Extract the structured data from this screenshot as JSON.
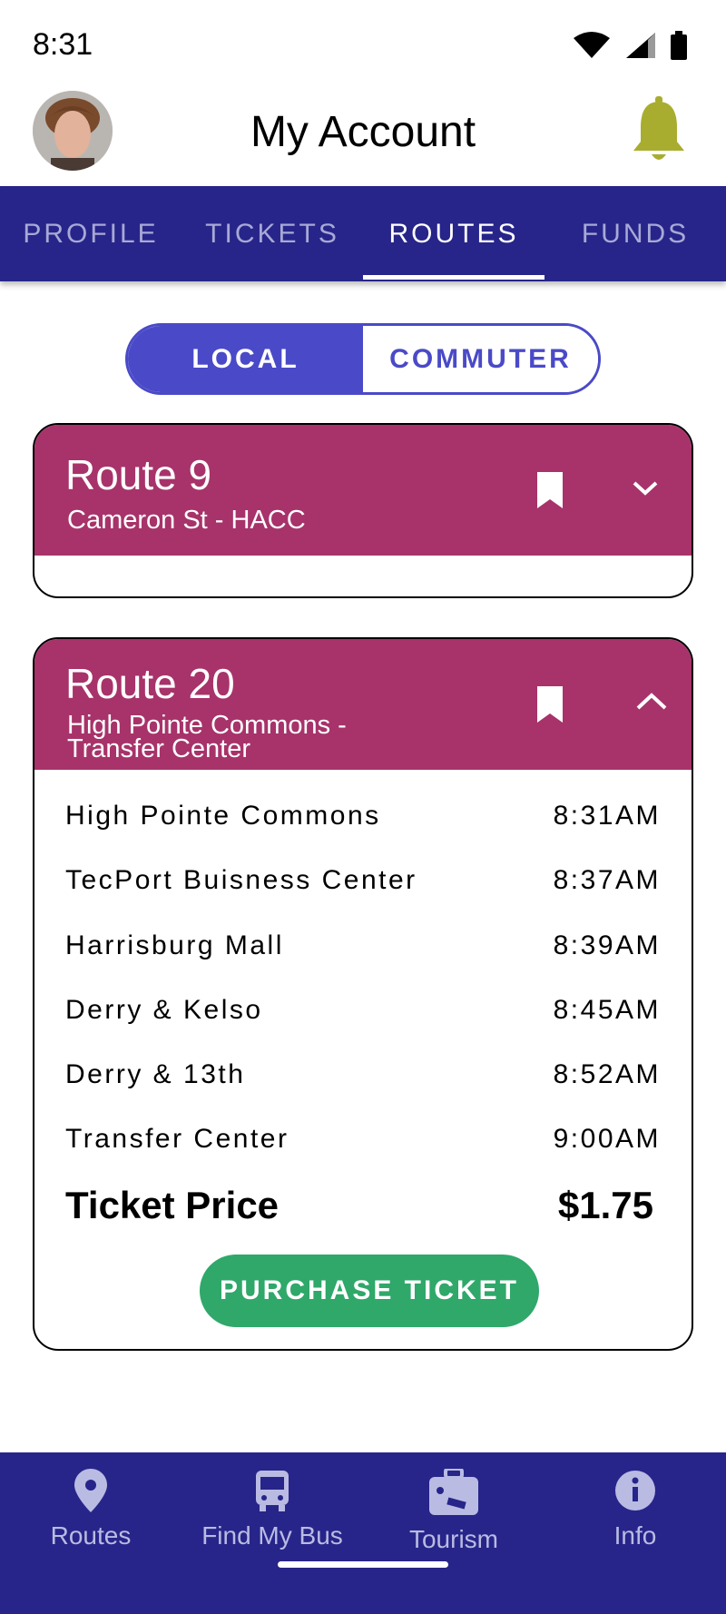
{
  "status_bar": {
    "time": "8:31"
  },
  "header": {
    "title": "My Account"
  },
  "tabs": [
    {
      "label": "PROFILE"
    },
    {
      "label": "TICKETS"
    },
    {
      "label": "ROUTES"
    },
    {
      "label": "FUNDS"
    }
  ],
  "active_tab": "ROUTES",
  "segment": {
    "local": "LOCAL",
    "commuter": "COMMUTER",
    "selected": "LOCAL"
  },
  "routes": [
    {
      "name": "Route 9",
      "subtitle": "Cameron St - HACC",
      "expanded": false
    },
    {
      "name": "Route 20",
      "subtitle_line1": "High Pointe Commons -",
      "subtitle_line2": "Transfer Center",
      "expanded": true,
      "stops": [
        {
          "name": "High Pointe Commons",
          "time": "8:31AM"
        },
        {
          "name": "TecPort Buisness Center",
          "time": "8:37AM"
        },
        {
          "name": "Harrisburg Mall",
          "time": "8:39AM"
        },
        {
          "name": "Derry & Kelso",
          "time": "8:45AM"
        },
        {
          "name": "Derry & 13th",
          "time": "8:52AM"
        },
        {
          "name": "Transfer Center",
          "time": "9:00AM"
        }
      ],
      "price_label": "Ticket Price",
      "price": "$1.75",
      "purchase_label": "PURCHASE TICKET"
    }
  ],
  "bottom_nav": [
    {
      "label": "Routes",
      "icon": "map-pin-icon"
    },
    {
      "label": "Find My Bus",
      "icon": "bus-icon"
    },
    {
      "label": "Tourism",
      "icon": "suitcase-icon"
    },
    {
      "label": "Info",
      "icon": "info-icon"
    }
  ],
  "colors": {
    "primary": "#272589",
    "accent": "#4a4ac8",
    "route_header": "#a7336a",
    "purchase": "#2fa86a",
    "bell": "#a9ad2f"
  }
}
